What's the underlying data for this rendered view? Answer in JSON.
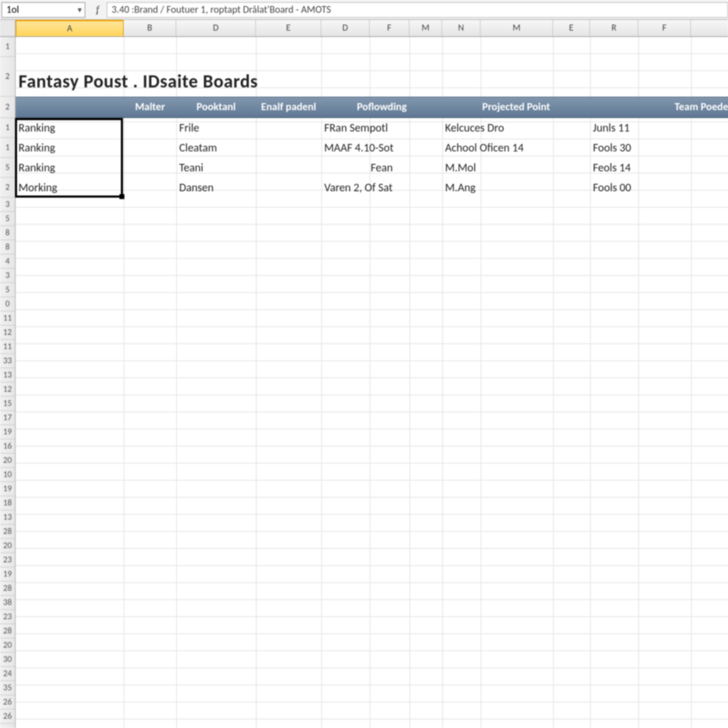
{
  "formula_bar": {
    "name_box": "1ol",
    "fx_label": "ᶂ",
    "formula": "3.40 :Brand / Foutuer 1, roptapt  Drålat'Board  - AMOTS"
  },
  "columns": [
    "A",
    "B",
    "D",
    "E",
    "D",
    "F",
    "M",
    "N",
    "M",
    "E",
    "R",
    "F",
    ""
  ],
  "row_numbers_top": [
    "1",
    "2",
    "2",
    "1",
    "1",
    "5",
    "2"
  ],
  "title": "Fantasy Poust . IDsaite Boards",
  "table_headers": {
    "h1": "",
    "h2": "Malter",
    "h3": "Pooktanl",
    "h4": "Enalf padenl",
    "h5": "Poflowding",
    "h6": "Projected Point",
    "h7": "Team Poedect"
  },
  "rows": [
    {
      "a": "Ranking",
      "d": "Frile",
      "pof": "FRan Sempotl",
      "proj": "Kelcuces Dro",
      "team": "Junls 11"
    },
    {
      "a": "Ranking",
      "d": "Cleatam",
      "pof": "MAAF 4.10-Sot",
      "proj": "Achool Oficen 14",
      "team": "Fools 30"
    },
    {
      "a": "Ranking",
      "d": "Teani",
      "pof": "Fean",
      "proj": "M.Mol",
      "team": "Feols 14"
    },
    {
      "a": "Morking",
      "d": "Dansen",
      "pof": "Varen 2, Of Sat",
      "proj": "M.Ang",
      "team": "Fools 00"
    }
  ],
  "empty_row_numbers": [
    "3",
    "5",
    "8",
    "8",
    "4",
    "3",
    "5",
    "0",
    "11",
    "12",
    "11",
    "33",
    "13",
    "12",
    "15",
    "17",
    "19",
    "16",
    "20",
    "10",
    "19",
    "18",
    "13",
    "28",
    "20",
    "23",
    "19",
    "28",
    "38",
    "23",
    "28",
    "20",
    "30",
    "24",
    "35",
    "26",
    "26"
  ]
}
